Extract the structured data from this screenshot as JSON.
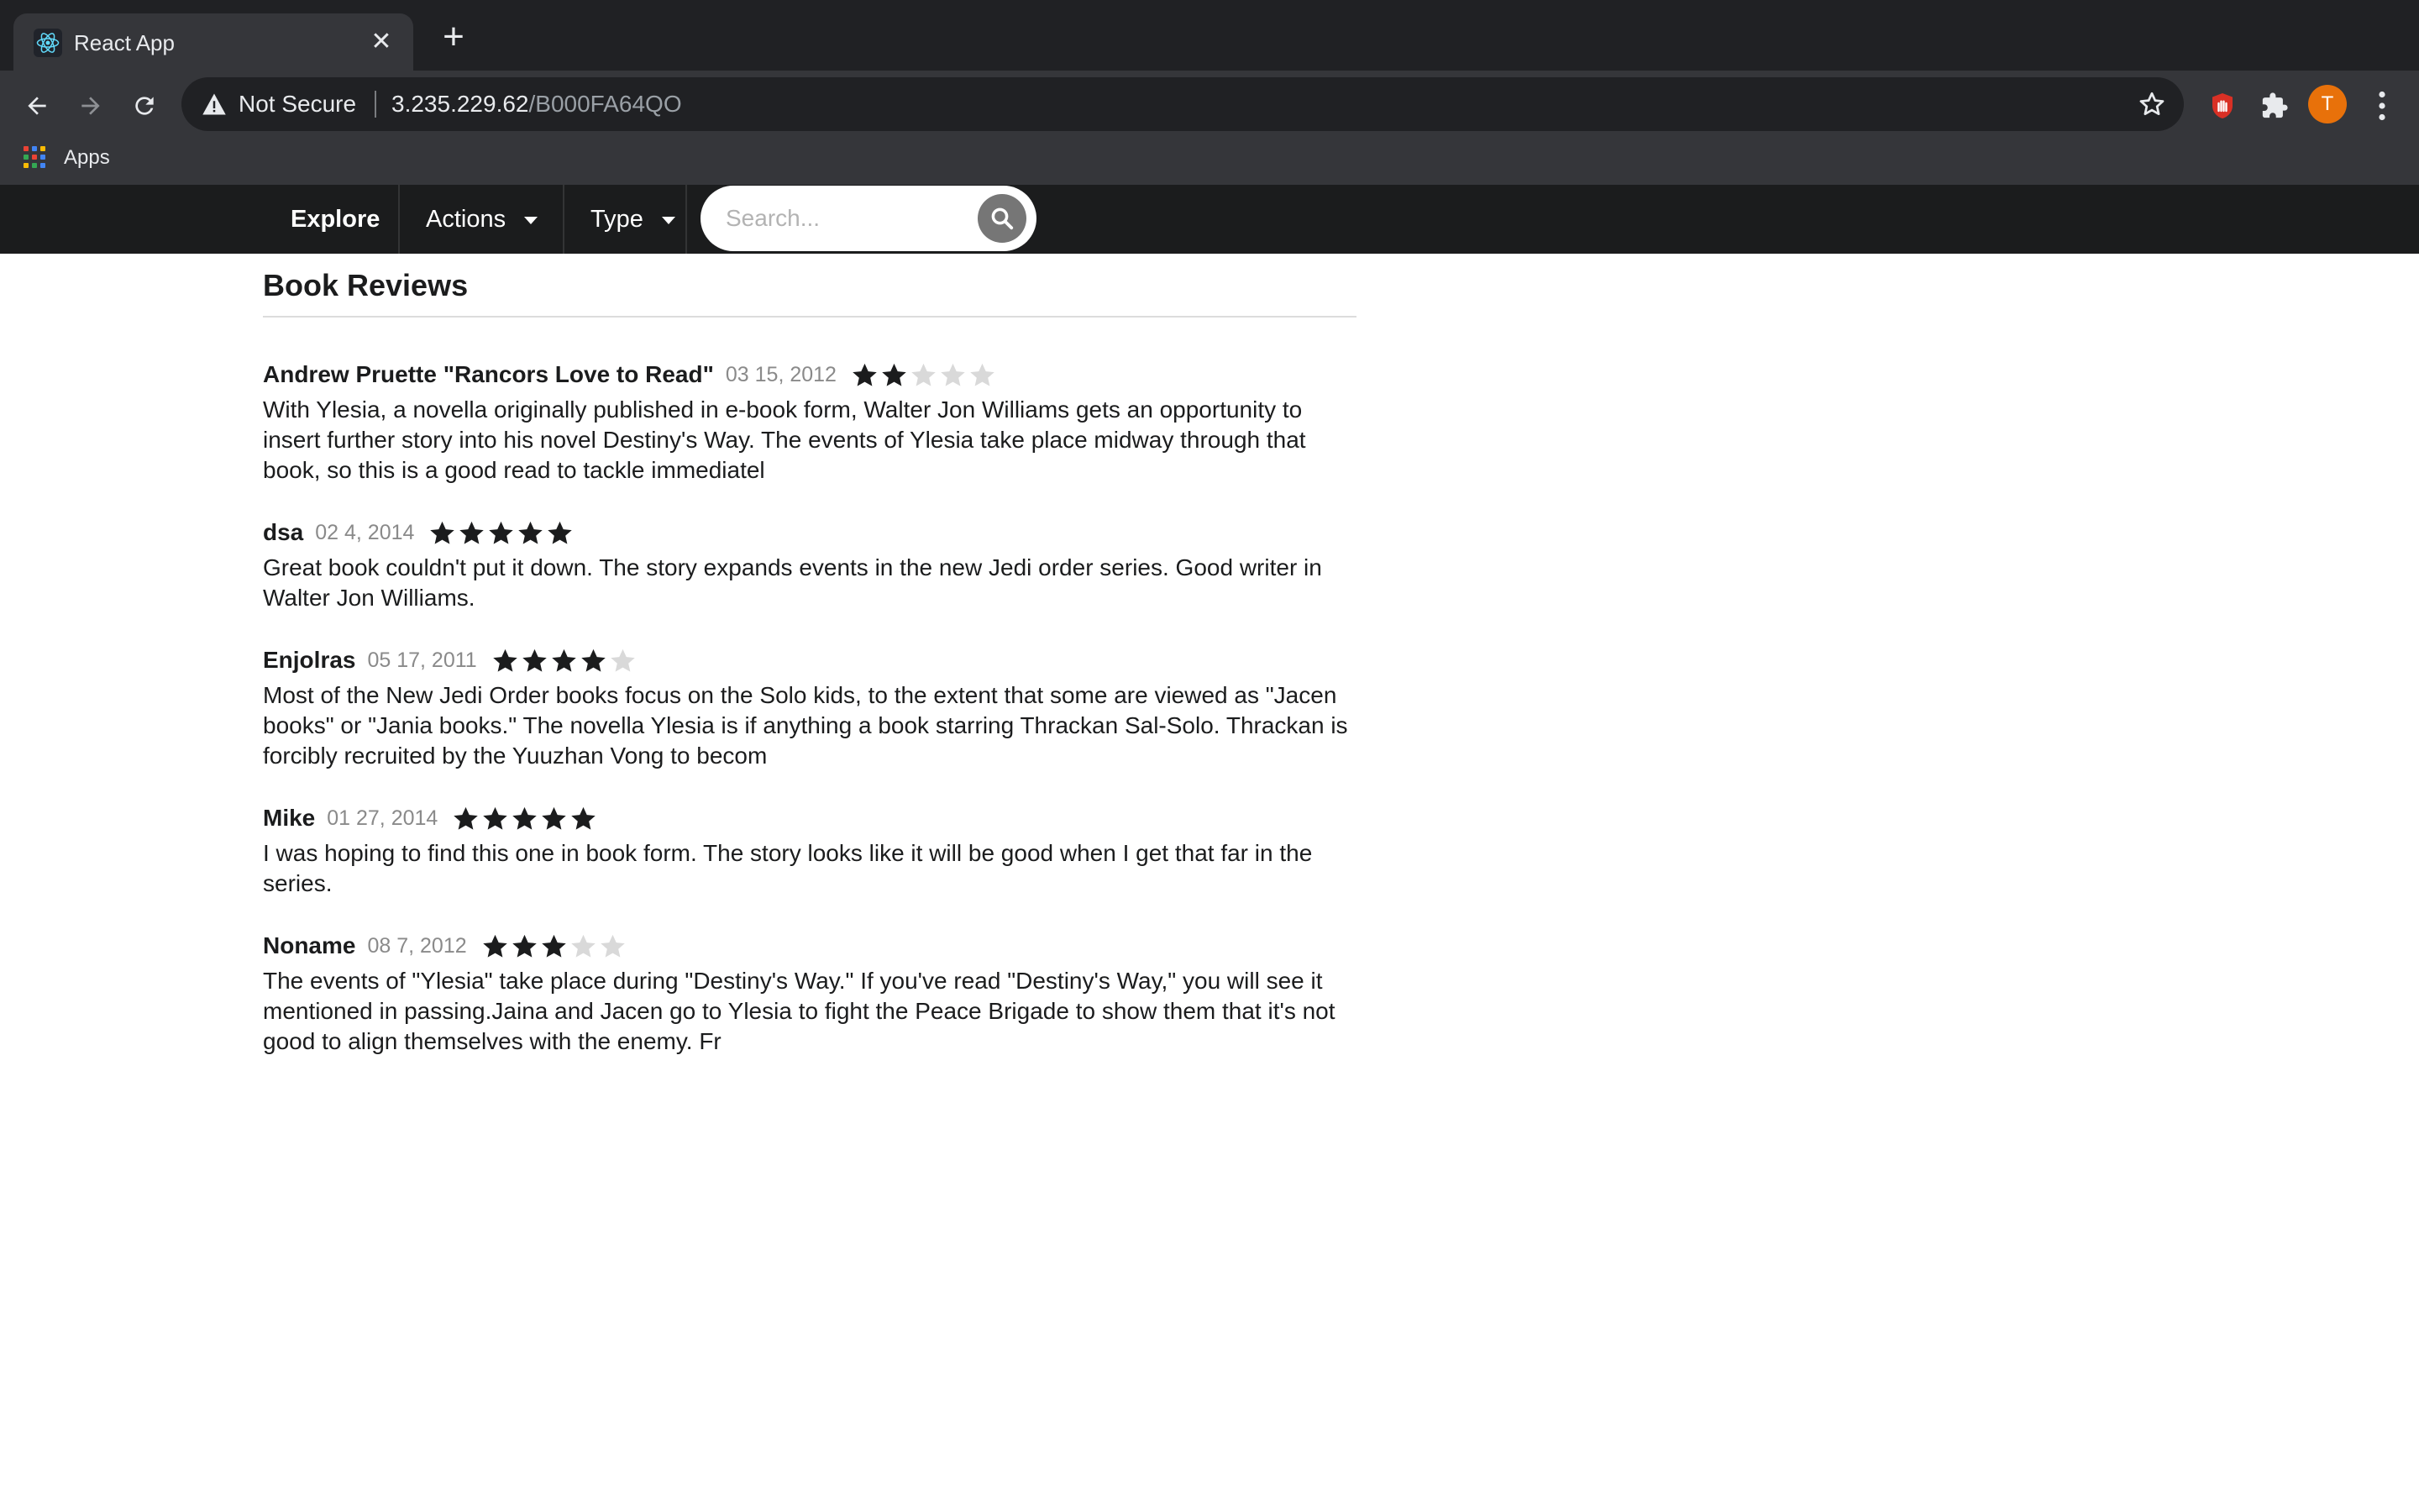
{
  "browser": {
    "tab_title": "React App",
    "url_security": "Not Secure",
    "url_host": "3.235.229.62",
    "url_path": "/B000FA64QO",
    "profile_initial": "T",
    "bookmark_apps_label": "Apps"
  },
  "navbar": {
    "explore": "Explore",
    "actions": "Actions",
    "type": "Type",
    "search_placeholder": "Search..."
  },
  "page": {
    "title": "Book Reviews"
  },
  "reviews": [
    {
      "name": "Andrew Pruette \"Rancors Love to Read\"",
      "date": "03 15, 2012",
      "rating": 2,
      "text": "With Ylesia, a novella originally published in e-book form, Walter Jon Williams gets an opportunity to insert further story into his novel Destiny's Way. The events of Ylesia take place midway through that book, so this is a good read to tackle immediatel"
    },
    {
      "name": "dsa",
      "date": "02 4, 2014",
      "rating": 5,
      "text": "Great book couldn't put it down. The story expands events in the new Jedi order series. Good writer in Walter Jon Williams."
    },
    {
      "name": "Enjolras",
      "date": "05 17, 2011",
      "rating": 4,
      "text": "Most of the New Jedi Order books focus on the Solo kids, to the extent that some are viewed as \"Jacen books\" or \"Jania books.\" The novella Ylesia is if anything a book starring Thrackan Sal-Solo. Thrackan is forcibly recruited by the Yuuzhan Vong to becom"
    },
    {
      "name": "Mike",
      "date": "01 27, 2014",
      "rating": 5,
      "text": "I was hoping to find this one in book form. The story looks like it will be good when I get that far in the series."
    },
    {
      "name": "Noname",
      "date": "08 7, 2012",
      "rating": 3,
      "text": "The events of \"Ylesia\" take place during \"Destiny's Way.\" If you've read \"Destiny's Way,\" you will see it mentioned in passing.Jaina and Jacen go to Ylesia to fight the Peace Brigade to show them that it's not good to align themselves with the enemy. Fr"
    }
  ],
  "colors": {
    "star_filled": "#1b1c1d",
    "star_empty": "#d9d9d9",
    "navbar_bg": "#1b1c1d",
    "profile_bg": "#e8710a"
  }
}
